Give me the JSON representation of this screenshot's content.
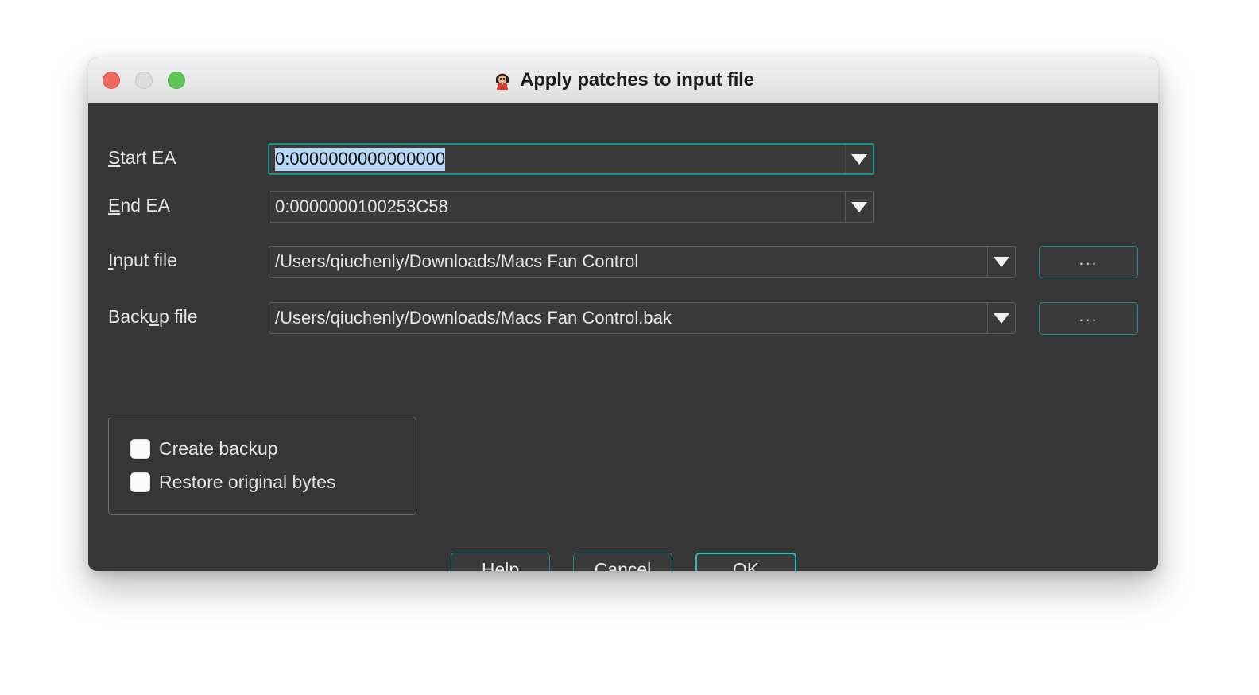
{
  "window": {
    "title": "Apply patches to input file",
    "icon": "app-avatar-icon",
    "traffic_lights": {
      "close": "close-button",
      "minimize": "minimize-button",
      "maximize": "maximize-button"
    }
  },
  "accent": {
    "teal_border": "#1d8f8a",
    "teal_focus": "#2cbfb6",
    "selection_blue": "#b9d8f6",
    "body_bg": "#363636"
  },
  "form": {
    "start_ea": {
      "label_pre": "S",
      "label_post": "tart EA",
      "value": "0:0000000000000000",
      "selected": true
    },
    "end_ea": {
      "label_pre": "E",
      "label_post": "nd EA",
      "value": "0:0000000100253C58",
      "selected": false
    },
    "input_file": {
      "label_pre": "I",
      "label_post": "nput file",
      "value": "/Users/qiuchenly/Downloads/Macs Fan Control",
      "browse_label": "..."
    },
    "backup_file": {
      "label_a": "Back",
      "label_mn": "u",
      "label_b": "p file",
      "value": "/Users/qiuchenly/Downloads/Macs Fan Control.bak",
      "browse_label": "..."
    }
  },
  "options": {
    "create_backup": {
      "label": "Create backup",
      "checked": false
    },
    "restore_original_bytes": {
      "label": "Restore original bytes",
      "checked": false
    }
  },
  "buttons": {
    "help": "Help",
    "cancel": "Cancel",
    "ok": "OK"
  }
}
